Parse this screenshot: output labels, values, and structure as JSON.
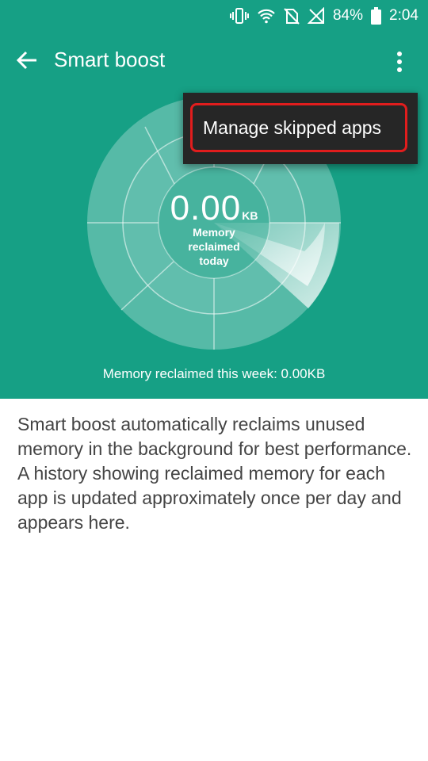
{
  "status_bar": {
    "battery_percent": "84%",
    "time": "2:04",
    "icons": [
      "vibrate-icon",
      "wifi-icon",
      "no-sim-icon",
      "no-signal-icon",
      "battery-icon"
    ]
  },
  "app_bar": {
    "title": "Smart boost",
    "back_icon": "arrow-back-icon",
    "overflow_icon": "more-vert-icon"
  },
  "dial": {
    "value": "0.00",
    "unit": "KB",
    "label": "Memory\nreclaimed\ntoday"
  },
  "weekly_summary": "Memory reclaimed this week: 0.00KB",
  "overflow_menu": {
    "items": [
      {
        "label": "Manage skipped apps",
        "highlighted": true
      }
    ]
  },
  "description": "Smart boost automatically reclaims unused memory in the background for best performance. A history showing reclaimed memory for each app is updated approximately once per day and appears here.",
  "colors": {
    "accent": "#16a085",
    "menu_background": "#262626",
    "highlight_border": "#e11d1d",
    "body_text": "#444444"
  }
}
